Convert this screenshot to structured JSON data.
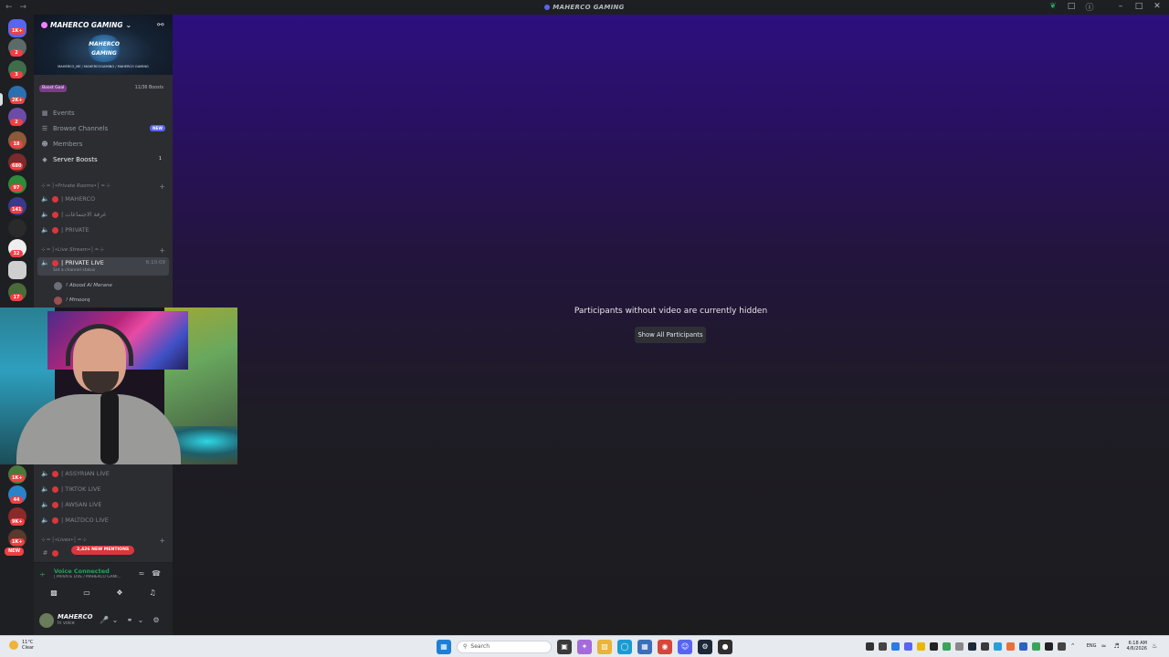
{
  "window": {
    "title": "MAHERCO GAMING"
  },
  "server_rail": {
    "badges": [
      "1K+",
      "2",
      "3",
      "2K+",
      "2",
      "18",
      "680",
      "97",
      "141",
      "32",
      "17",
      "1K+",
      "44",
      "9K+",
      "1K+",
      "NEW"
    ]
  },
  "server": {
    "name": "MAHERCO GAMING",
    "banner_logo": "MAHERCO GAMING",
    "banner_handles": "MAHERCO_ME / MAHERCOGAMING / MAHERCO GAMING",
    "boost_goal_label": "Boost Goal",
    "boost_count": "11/36 Boosts"
  },
  "nav": {
    "events": "Events",
    "browse_channels": "Browse Channels",
    "browse_badge": "NEW",
    "members": "Members",
    "server_boosts": "Server Boosts",
    "server_boosts_count": "1"
  },
  "channels": {
    "cat_private_rooms": "⊹ ━ │•Private Rooms•│ ━ ⊹",
    "private_rooms": [
      "| MAHERCO",
      "| غرفة الاجتماعات",
      "| PRIVATE"
    ],
    "cat_live_stream": "⊹ ━ │•Live Stream•│ ━ ⊹",
    "active_channel": "| PRIVATE LIVE",
    "active_timer": "6:10:09",
    "active_status": "Set a channel status",
    "voice_users": [
      "! Abood Al Merane",
      "! Mmoorq"
    ],
    "live_channels": [
      "| ASSYRIAN LIVE",
      "| TIKTOK LIVE",
      "| AWSAN LIVE",
      "| MALTDCO LIVE"
    ],
    "cat_lives": "⊹ ━ │•Lives•│ ━ ⊹",
    "mentions_pill": "2,426 NEW MENTIONS"
  },
  "voice_panel": {
    "status": "Voice Connected",
    "channel": "| PRIVATE LIVE / MAHERCO GAMI..."
  },
  "user": {
    "name": "MAHERCO",
    "status": "In voice"
  },
  "main": {
    "hidden_message": "Participants without video are currently hidden",
    "show_all_button": "Show All Participants"
  },
  "taskbar": {
    "weather_temp": "11°C",
    "weather_desc": "Clear",
    "search_placeholder": "Search",
    "lang": "ENG",
    "time": "6:18 AM",
    "date": "4/6/2026"
  },
  "colors": {
    "accent": "#5865f2",
    "danger": "#da373c",
    "online": "#23a55a",
    "main_top": "#2d0f7e"
  }
}
